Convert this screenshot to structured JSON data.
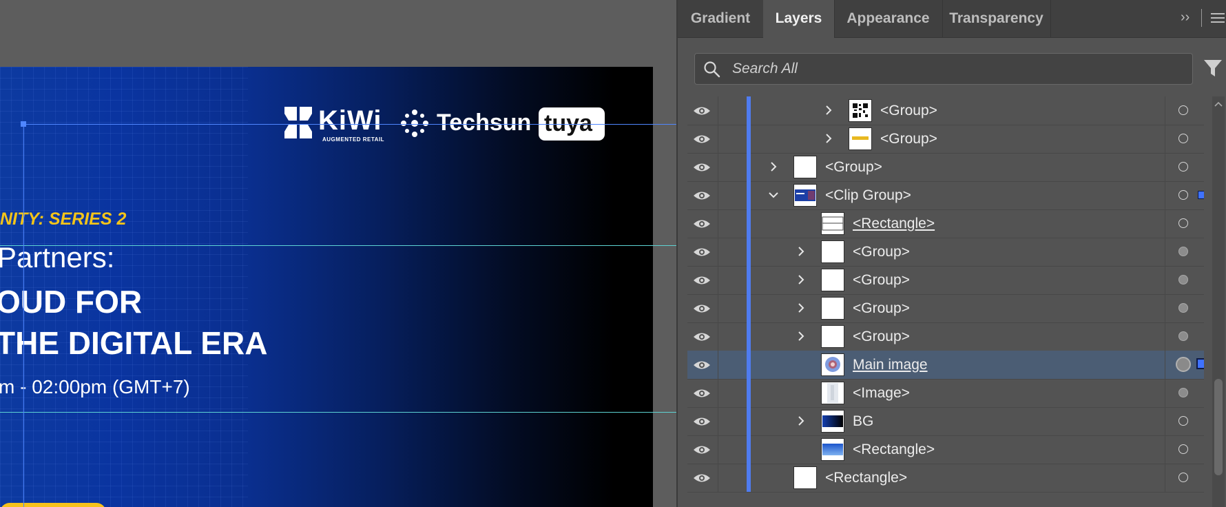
{
  "artboard": {
    "logo_kiwi": "KiWi",
    "logo_kiwi_sub": "AUGMENTED RETAIL",
    "logo_techsun": "Techsun",
    "logo_tuya": "tuya",
    "series": "NITY: SERIES 2",
    "headline_1": "Partners:",
    "headline_2": "OUD FOR",
    "headline_3": "THE DIGITAL ERA",
    "time": "m - 02:00pm (GMT+7)"
  },
  "panel": {
    "tabs": [
      {
        "label": "Gradient",
        "active": false
      },
      {
        "label": "Layers",
        "active": true
      },
      {
        "label": "Appearance",
        "active": false
      },
      {
        "label": "Transparency",
        "active": false
      }
    ],
    "collapse_glyph": "››",
    "search_placeholder": "Search All",
    "layers": [
      {
        "name": "<Group>",
        "underline": false,
        "thumb": "qr"
      },
      {
        "name": "<Group>",
        "underline": false,
        "thumb": "yellow"
      },
      {
        "name": "<Group>",
        "underline": false,
        "thumb": "blank"
      },
      {
        "name": "<Clip Group>",
        "underline": false,
        "thumb": "banner"
      },
      {
        "name": "<Rectangle>",
        "underline": true,
        "thumb": "lines"
      },
      {
        "name": "<Group>",
        "underline": false,
        "thumb": "blank"
      },
      {
        "name": "<Group>",
        "underline": false,
        "thumb": "blank"
      },
      {
        "name": "<Group>",
        "underline": false,
        "thumb": "blank"
      },
      {
        "name": "<Group>",
        "underline": false,
        "thumb": "blank"
      },
      {
        "name": "Main image",
        "underline": true,
        "thumb": "photo"
      },
      {
        "name": "<Image>",
        "underline": false,
        "thumb": "pale"
      },
      {
        "name": "BG",
        "underline": false,
        "thumb": "gradient"
      },
      {
        "name": "<Rectangle>",
        "underline": false,
        "thumb": "gradient2"
      },
      {
        "name": "<Rectangle>",
        "underline": false,
        "thumb": "white"
      }
    ]
  }
}
